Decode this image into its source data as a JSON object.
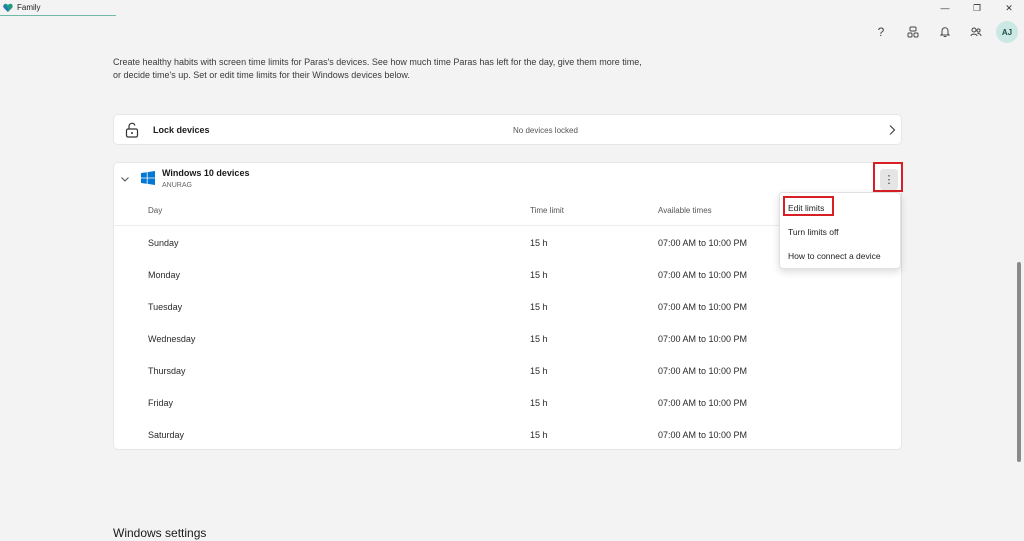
{
  "app": {
    "title": "Family"
  },
  "window_controls": {
    "minimize": "—",
    "maximize": "❐",
    "close": "✕"
  },
  "toolbar": {
    "help": "?",
    "avatar_initials": "AJ"
  },
  "intro": "Create healthy habits with screen time limits for Paras's devices. See how much time Paras has left for the day, give them more time, or decide time's up. Set or edit time limits for their Windows devices below.",
  "lock_devices": {
    "label": "Lock devices",
    "status": "No devices locked"
  },
  "devices": {
    "title": "Windows 10 devices",
    "device_name": "ANURAG",
    "more_label": "⋮",
    "columns": {
      "day": "Day",
      "time_limit": "Time limit",
      "available_times": "Available times"
    },
    "rows": [
      {
        "day": "Sunday",
        "limit": "15 h",
        "available": "07:00 AM to 10:00 PM"
      },
      {
        "day": "Monday",
        "limit": "15 h",
        "available": "07:00 AM to 10:00 PM"
      },
      {
        "day": "Tuesday",
        "limit": "15 h",
        "available": "07:00 AM to 10:00 PM"
      },
      {
        "day": "Wednesday",
        "limit": "15 h",
        "available": "07:00 AM to 10:00 PM"
      },
      {
        "day": "Thursday",
        "limit": "15 h",
        "available": "07:00 AM to 10:00 PM"
      },
      {
        "day": "Friday",
        "limit": "15 h",
        "available": "07:00 AM to 10:00 PM"
      },
      {
        "day": "Saturday",
        "limit": "15 h",
        "available": "07:00 AM to 10:00 PM"
      }
    ]
  },
  "context_menu": {
    "items": [
      {
        "label": "Edit limits"
      },
      {
        "label": "Turn limits off"
      },
      {
        "label": "How to connect a device"
      }
    ]
  },
  "windows_settings": {
    "title": "Windows settings"
  },
  "colors": {
    "highlight": "#d81f26",
    "accent": "#0078d4",
    "avatar_bg": "#cbe8e4"
  }
}
